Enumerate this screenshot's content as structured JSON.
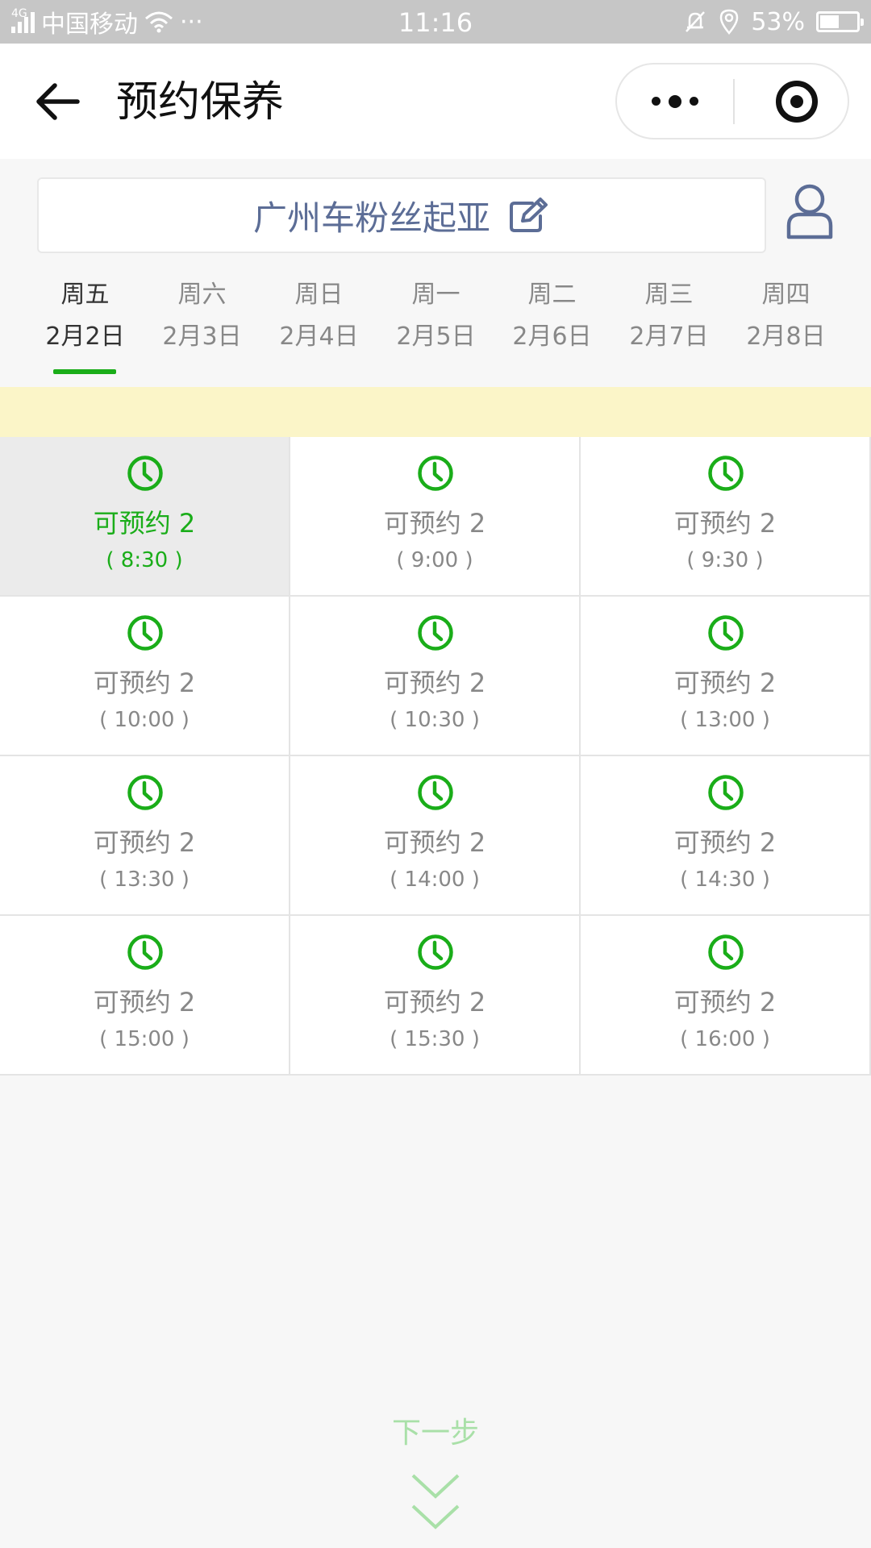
{
  "status_bar": {
    "network": "4G",
    "carrier": "中国移动",
    "more": "···",
    "time": "11:16",
    "battery": "53%",
    "battery_level": 0.53
  },
  "nav": {
    "title": "预约保养"
  },
  "store": {
    "name": "广州车粉丝起亚"
  },
  "date_tabs": [
    {
      "weekday": "周五",
      "date": "2月2日",
      "active": true
    },
    {
      "weekday": "周六",
      "date": "2月3日",
      "active": false
    },
    {
      "weekday": "周日",
      "date": "2月4日",
      "active": false
    },
    {
      "weekday": "周一",
      "date": "2月5日",
      "active": false
    },
    {
      "weekday": "周二",
      "date": "2月6日",
      "active": false
    },
    {
      "weekday": "周三",
      "date": "2月7日",
      "active": false
    },
    {
      "weekday": "周四",
      "date": "2月8日",
      "active": false
    }
  ],
  "slots": [
    {
      "label": "可预约 2",
      "time": "( 8:30 )",
      "selected": true
    },
    {
      "label": "可预约 2",
      "time": "( 9:00 )",
      "selected": false
    },
    {
      "label": "可预约 2",
      "time": "( 9:30 )",
      "selected": false
    },
    {
      "label": "可预约 2",
      "time": "( 10:00 )",
      "selected": false
    },
    {
      "label": "可预约 2",
      "time": "( 10:30 )",
      "selected": false
    },
    {
      "label": "可预约 2",
      "time": "( 13:00 )",
      "selected": false
    },
    {
      "label": "可预约 2",
      "time": "( 13:30 )",
      "selected": false
    },
    {
      "label": "可预约 2",
      "time": "( 14:00 )",
      "selected": false
    },
    {
      "label": "可预约 2",
      "time": "( 14:30 )",
      "selected": false
    },
    {
      "label": "可预约 2",
      "time": "( 15:00 )",
      "selected": false
    },
    {
      "label": "可预约 2",
      "time": "( 15:30 )",
      "selected": false
    },
    {
      "label": "可预约 2",
      "time": "( 16:00 )",
      "selected": false
    }
  ],
  "next_step": {
    "label": "下一步"
  },
  "icons": {
    "back": "back-arrow-icon",
    "more": "more-dots-icon",
    "close": "target-circle-icon",
    "edit": "edit-pencil-icon",
    "user": "user-icon",
    "slot_clock": "clock-icon",
    "next_arrows": "double-chevron-down-icon"
  },
  "colors": {
    "accent_green": "#1aad19",
    "store_text": "#5c6d96",
    "notice_band": "#fbf5c8",
    "next_step_text": "#a9e0a8"
  }
}
